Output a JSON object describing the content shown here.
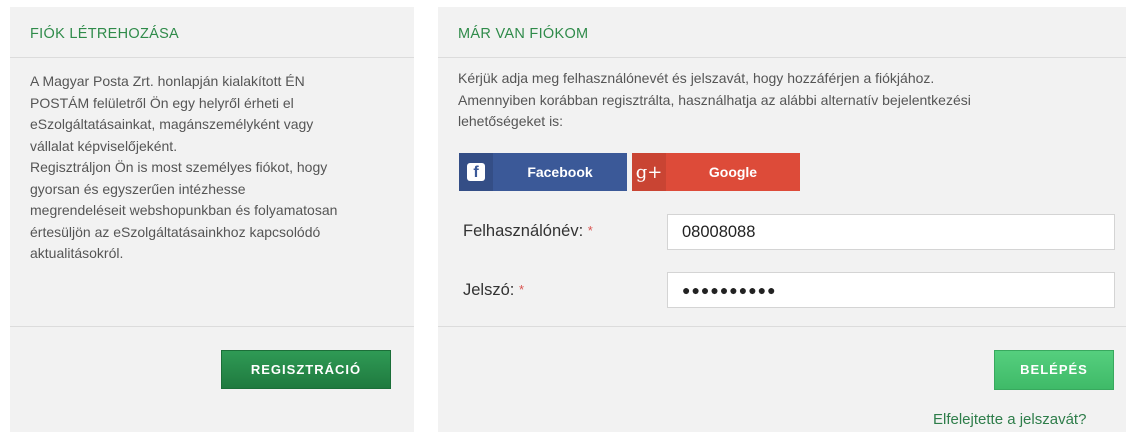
{
  "register_panel": {
    "title": "FIÓK LÉTREHOZÁSA",
    "lines": [
      "A Magyar Posta Zrt. honlapján kialakított ÉN",
      "POSTÁM felületről Ön egy helyről érheti el",
      "eSzolgáltatásainkat, magánszemélyként vagy",
      "vállalat képviselőjeként.",
      "Regisztráljon Ön is most személyes fiókot, hogy",
      "gyorsan és egyszerűen intézhesse",
      "megrendeléseit webshopunkban és folyamatosan",
      "értesüljön az eSzolgáltatásainkhoz kapcsolódó",
      "aktualitásokról."
    ],
    "button_label": "REGISZTRÁCIÓ"
  },
  "login_panel": {
    "title": "MÁR VAN FIÓKOM",
    "lines": [
      "Kérjük adja meg felhasználónevét és jelszavát, hogy hozzáférjen a fiókjához.",
      "Amennyiben korábban regisztrálta, használhatja az alábbi alternatív bejelentkezési",
      "lehetőségeket is:"
    ],
    "facebook_label": "Facebook",
    "google_label": "Google",
    "facebook_icon": "f",
    "google_icon": "g+",
    "username_label": "Felhasználónév:",
    "username_value": "08008088",
    "password_label": "Jelszó:",
    "password_value": "●●●●●●●●●●",
    "required_mark": "*",
    "button_label": "BELÉPÉS",
    "forgot_link": "Elfelejtette a jelszavát?"
  },
  "colors": {
    "accent": "#2f8b4a",
    "facebook": "#3b5998",
    "google": "#dd4b39",
    "required": "#d9534f"
  }
}
